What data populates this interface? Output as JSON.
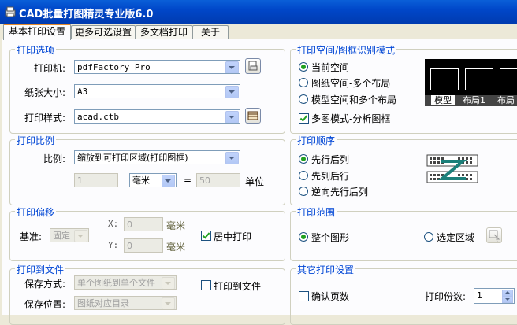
{
  "window": {
    "title": "CAD批量打图精灵专业版6.0"
  },
  "tabs": [
    {
      "label": "基本打印设置"
    },
    {
      "label": "更多可选设置"
    },
    {
      "label": "多文档打印"
    },
    {
      "label": "关于"
    }
  ],
  "print_options": {
    "legend": "打印选项",
    "printer_label": "打印机:",
    "printer_value": "pdfFactory Pro",
    "paper_label": "纸张大小:",
    "paper_value": "A3",
    "style_label": "打印样式:",
    "style_value": "acad.ctb"
  },
  "print_space": {
    "legend": "打印空间/图框识别模式",
    "options": [
      {
        "label": "当前空间",
        "checked": true
      },
      {
        "label": "图纸空间-多个布局",
        "checked": false
      },
      {
        "label": "模型空间和多个布局",
        "checked": false
      }
    ],
    "multi_frame_label": "多图模式-分析图框",
    "multi_frame_checked": true,
    "preview_tabs": [
      "模型",
      "布局1",
      "布局"
    ]
  },
  "print_scale": {
    "legend": "打印比例",
    "scale_label": "比例:",
    "scale_value": "缩放到可打印区域(打印图框)",
    "value_left": "1",
    "unit_select": "毫米",
    "equals": "=",
    "value_right": "50",
    "unit_label": "单位"
  },
  "print_order": {
    "legend": "打印顺序",
    "options": [
      {
        "label": "先行后列",
        "checked": true
      },
      {
        "label": "先列后行",
        "checked": false
      },
      {
        "label": "逆向先行后列",
        "checked": false
      }
    ]
  },
  "print_offset": {
    "legend": "打印偏移",
    "base_label": "基准:",
    "base_value": "固定",
    "x_label": "X:",
    "x_value": "0",
    "x_unit": "毫米",
    "y_label": "Y:",
    "y_value": "0",
    "y_unit": "毫米",
    "center_label": "居中打印",
    "center_checked": true
  },
  "print_range": {
    "legend": "打印范围",
    "options": [
      {
        "label": "整个图形",
        "checked": true
      },
      {
        "label": "选定区域",
        "checked": false
      }
    ]
  },
  "print_to_file": {
    "legend": "打印到文件",
    "save_mode_label": "保存方式:",
    "save_mode_value": "单个图纸到单个文件",
    "save_loc_label": "保存位置:",
    "save_loc_value": "图纸对应目录",
    "to_file_label": "打印到文件",
    "to_file_checked": false
  },
  "other_settings": {
    "legend": "其它打印设置",
    "confirm_pages_label": "确认页数",
    "confirm_pages_checked": false,
    "copies_label": "打印份数:",
    "copies_value": "1"
  }
}
